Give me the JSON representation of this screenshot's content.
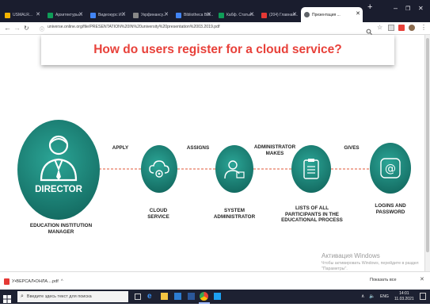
{
  "browser": {
    "tabs": [
      {
        "label": "USMALR...",
        "favicon": "#f4b400"
      },
      {
        "label": "Архитектуры...",
        "favicon": "#0f9d58"
      },
      {
        "label": "Видеокурс И...",
        "favicon": "#4285f4"
      },
      {
        "label": "Укрфинансу...",
        "favicon": "#888888"
      },
      {
        "label": "Bibliotheca Bib...",
        "favicon": "#4285f4"
      },
      {
        "label": "Кабф. Статья...",
        "favicon": "#0f9d58"
      },
      {
        "label": "(204) Главная...",
        "favicon": "#e53935"
      },
      {
        "label": "Презентация ...",
        "favicon": "#5f6368"
      }
    ],
    "url": "universe.online.org/file/PRESENTATION%20IN%20university%20presentation%2003.2019.pdf"
  },
  "slide": {
    "title": "How do users register for a cloud service?",
    "nodes": [
      {
        "label": "DIRECTOR",
        "sub": "EDUCATION INSTITUTION MANAGER"
      },
      {
        "label": "CLOUD SERVICE"
      },
      {
        "label": "SYSTEM ADMINISTRATOR"
      },
      {
        "label": "LISTS OF ALL PARTICIPANTS IN THE EDUCATIONAL PROCESS"
      },
      {
        "label": "LOGINS AND PASSWORD"
      }
    ],
    "arrows": [
      "APPLY",
      "ASSIGNS",
      "ADMINISTRATOR MAKES",
      "GIVES"
    ],
    "accent": "#e8413a",
    "circle_color": "#14786c"
  },
  "watermark": {
    "title": "Активация Windows",
    "text": "Чтобы активировать Windows, перейдите в раздел \"Параметры\"."
  },
  "download": {
    "file": "У•ВЕРСАЛ•ОНЛА....pdf",
    "show_all": "Показать все"
  },
  "taskbar": {
    "search": "Введите здесь текст для поиска",
    "lang": "ENG",
    "time": "14:01",
    "date": "11.03.2021"
  }
}
